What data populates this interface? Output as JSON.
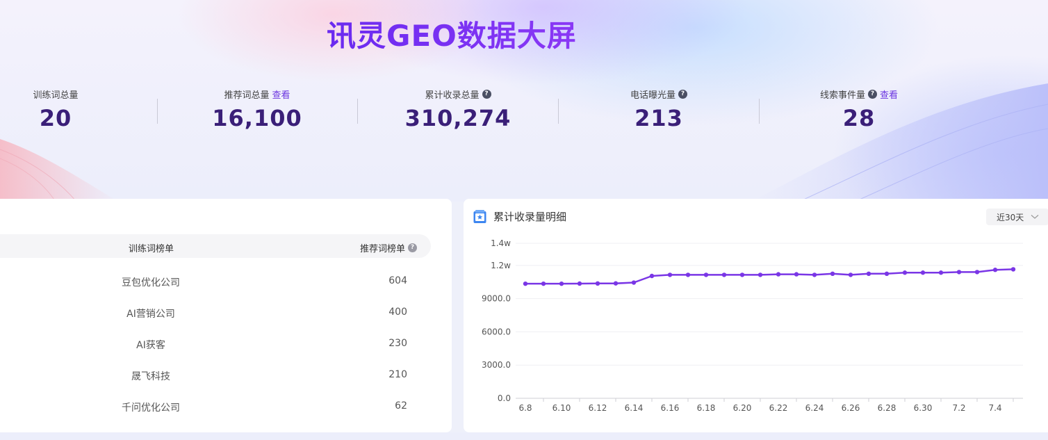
{
  "header": {
    "title": "讯灵GEO数据大屏"
  },
  "stats": [
    {
      "label": "训练词总量",
      "value": "20",
      "link": "",
      "help": false
    },
    {
      "label": "推荐词总量",
      "value": "16,100",
      "link": "查看",
      "help": false
    },
    {
      "label": "累计收录总量",
      "value": "310,274",
      "link": "",
      "help": true
    },
    {
      "label": "电话曝光量",
      "value": "213",
      "link": "",
      "help": true
    },
    {
      "label": "线索事件量",
      "value": "28",
      "link": "查看",
      "help": true
    }
  ],
  "ranking": {
    "col_training": "训练词榜单",
    "col_recommend": "推荐词榜单",
    "rows": [
      {
        "name": "豆包优化公司",
        "value": "604"
      },
      {
        "name": "AI营销公司",
        "value": "400"
      },
      {
        "name": "AI获客",
        "value": "230"
      },
      {
        "name": "晟飞科技",
        "value": "210"
      },
      {
        "name": "千问优化公司",
        "value": "62"
      }
    ]
  },
  "chart_panel": {
    "title": "累计收录量明细",
    "range_label": "近30天",
    "icons": {
      "title": "clipboard-star-icon",
      "range": "chevron-down-icon"
    }
  },
  "colors": {
    "accent": "#7a36e6",
    "title": "#7a2ff0",
    "stat_value": "#3a1f78"
  },
  "chart_data": {
    "type": "line",
    "title": "累计收录量明细",
    "xlabel": "",
    "ylabel": "",
    "ylim": [
      0,
      14000
    ],
    "yticks": [
      0,
      3000,
      6000,
      9000,
      12000,
      14000
    ],
    "ytick_labels": [
      "0.0",
      "3000.0",
      "6000.0",
      "9000.0",
      "1.2w",
      "1.4w"
    ],
    "xtick_labels": [
      "6.8",
      "6.10",
      "6.12",
      "6.14",
      "6.16",
      "6.18",
      "6.20",
      "6.22",
      "6.24",
      "6.26",
      "6.28",
      "6.30",
      "7.2",
      "7.4"
    ],
    "x": [
      "6.8",
      "6.9",
      "6.10",
      "6.11",
      "6.12",
      "6.13",
      "6.14",
      "6.15",
      "6.16",
      "6.17",
      "6.18",
      "6.19",
      "6.20",
      "6.21",
      "6.22",
      "6.23",
      "6.24",
      "6.25",
      "6.26",
      "6.27",
      "6.28",
      "6.29",
      "6.30",
      "7.1",
      "7.2",
      "7.3",
      "7.4",
      "7.5"
    ],
    "series": [
      {
        "values": [
          10350,
          10350,
          10350,
          10360,
          10370,
          10380,
          10450,
          11050,
          11150,
          11150,
          11150,
          11150,
          11150,
          11150,
          11200,
          11200,
          11150,
          11250,
          11150,
          11250,
          11250,
          11350,
          11350,
          11350,
          11400,
          11400,
          11600,
          11650
        ]
      }
    ],
    "grid": true,
    "legend": "none",
    "color": "#7a36e6"
  }
}
